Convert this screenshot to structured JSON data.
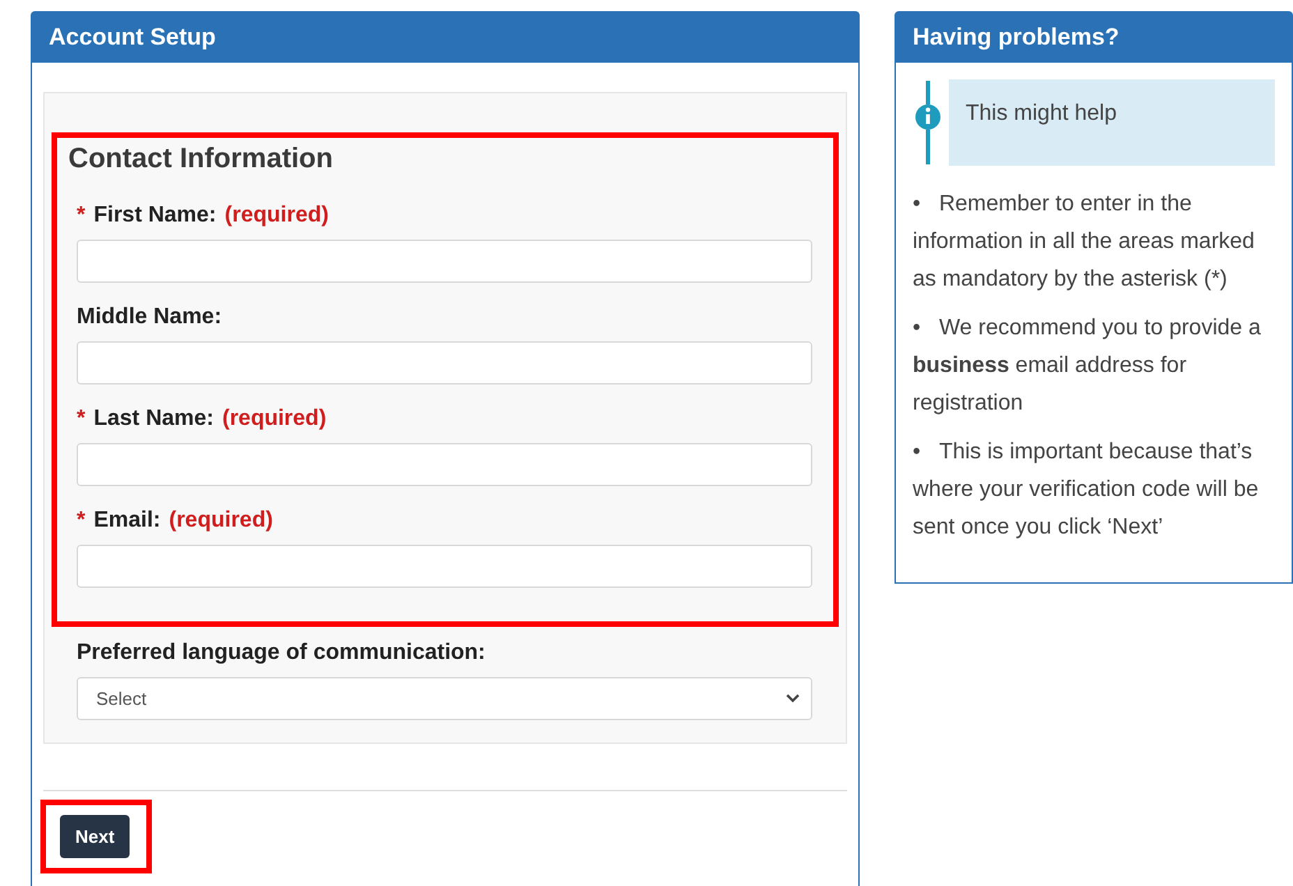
{
  "setup_panel": {
    "title": "Account Setup",
    "contact_section": {
      "heading": "Contact Information",
      "highlighted": true,
      "fields": [
        {
          "marker": "*",
          "label": "First Name:",
          "note": "(required)"
        },
        {
          "label": "Middle Name:"
        },
        {
          "marker": "*",
          "label": "Last Name:",
          "note": "(required)"
        },
        {
          "marker": "*",
          "label": "Email:",
          "note": "(required)"
        }
      ]
    },
    "language": {
      "label": "Preferred language of communication:",
      "value": "Select"
    },
    "next_button": {
      "label": "Next",
      "highlighted": true
    }
  },
  "help_panel": {
    "title": "Having problems?",
    "callout": "This might help",
    "tips": [
      {
        "bullet": "•",
        "text": "Remember to enter in the information in all the areas marked as mandatory by the asterisk (*)"
      },
      {
        "bullet": "•",
        "text": "We recommend you to provide a **business** email address for registration"
      },
      {
        "bullet": "•",
        "text": "This is important because that’s where your verification code will be sent once you click ‘Next’"
      }
    ]
  }
}
